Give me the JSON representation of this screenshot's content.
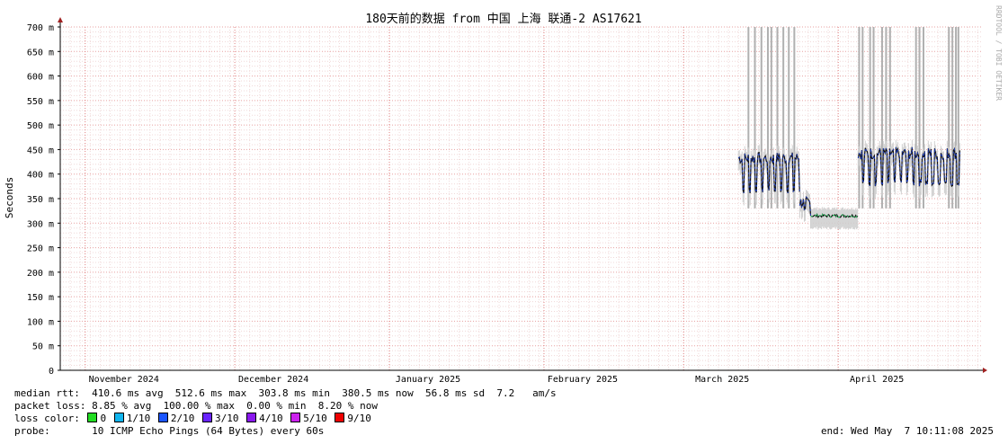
{
  "chart_data": {
    "type": "line",
    "title": "180天前的数据 from 中国 上海 联通-2 AS17621",
    "ylabel": "Seconds",
    "watermark": "RRDTOOL / TOBI OETIKER",
    "ylim": [
      0,
      700
    ],
    "y_ticks": [
      "0",
      "50 m",
      "100 m",
      "150 m",
      "200 m",
      "250 m",
      "300 m",
      "350 m",
      "400 m",
      "450 m",
      "500 m",
      "550 m",
      "600 m",
      "650 m",
      "700 m"
    ],
    "x_ticks": [
      "November 2024",
      "December 2024",
      "January 2025",
      "February 2025",
      "March 2025",
      "April 2025"
    ],
    "x_range_days": [
      0,
      185
    ],
    "x_tick_days": [
      5,
      35,
      66,
      97,
      125,
      156
    ],
    "segments": [
      {
        "day_start": 136.0,
        "day_end": 148.3,
        "base": 430,
        "low": 360,
        "color": "#1a3fd1"
      },
      {
        "day_start": 148.3,
        "day_end": 150.5,
        "base": 340,
        "low": 315,
        "color": "#1a3fd1"
      },
      {
        "day_start": 150.5,
        "day_end": 160.0,
        "base": 315,
        "low": 310,
        "color": "#22dd66"
      },
      {
        "day_start": 160.0,
        "day_end": 180.5,
        "base": 440,
        "low": 375,
        "color": "#1a3fd1"
      }
    ],
    "loss_spike_days": [
      138.0,
      139.3,
      140.6,
      141.9,
      142.6,
      143.8,
      145.0,
      146.1,
      147.2,
      160.2,
      160.9,
      162.4,
      163.1,
      164.8,
      165.6,
      166.4,
      171.6,
      172.3,
      173.1,
      178.2,
      178.9,
      179.6,
      180.1
    ]
  },
  "stats": {
    "median_rtt": "median rtt:  410.6 ms avg  512.6 ms max  303.8 ms min  380.5 ms now  56.8 ms sd  7.2   am/s",
    "packet_loss": "packet loss: 8.85 % avg  100.00 % max  0.00 % min  8.20 % now",
    "loss_color_label": "loss color:",
    "loss_colors": [
      {
        "label": "0",
        "color": "#22dd22"
      },
      {
        "label": "1/10",
        "color": "#11b5ee"
      },
      {
        "label": "2/10",
        "color": "#1a55ff"
      },
      {
        "label": "3/10",
        "color": "#6a24ff"
      },
      {
        "label": "4/10",
        "color": "#8a18ee"
      },
      {
        "label": "5/10",
        "color": "#cc22ee"
      },
      {
        "label": "9/10",
        "color": "#ee0000"
      }
    ],
    "probe_label": "probe:",
    "probe_value": "10 ICMP Echo Pings (64 Bytes) every 60s",
    "end": "end: Wed May  7 10:11:08 2025"
  }
}
